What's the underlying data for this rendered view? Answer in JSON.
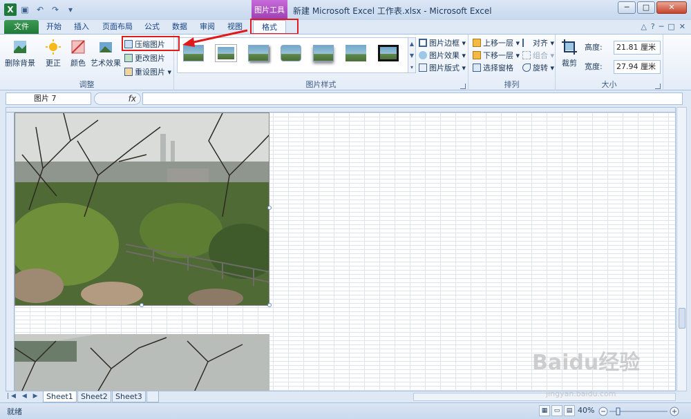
{
  "titlebar": {
    "app_icon": "X",
    "context_tab_title": "图片工具",
    "window_title": "新建 Microsoft Excel 工作表.xlsx - Microsoft Excel",
    "controls": [
      "─",
      "□",
      "✕"
    ]
  },
  "tabs": {
    "file": "文件",
    "items": [
      "开始",
      "插入",
      "页面布局",
      "公式",
      "数据",
      "审阅",
      "视图",
      "格式"
    ],
    "active": "格式",
    "right_icons": [
      "△",
      "?",
      "─",
      "□",
      "✕"
    ]
  },
  "ribbon": {
    "adjust_group": {
      "label": "调整",
      "remove_bg": "删除背景",
      "corrections": "更正",
      "color": "颜色",
      "artistic": "艺术效果",
      "compress": "压缩图片",
      "change": "更改图片",
      "reset": "重设图片"
    },
    "styles_group": {
      "label": "图片样式",
      "border": "图片边框",
      "effects": "图片效果",
      "layout": "图片版式"
    },
    "arrange_group": {
      "label": "排列",
      "bring_forward": "上移一层",
      "send_backward": "下移一层",
      "selection_pane": "选择窗格",
      "align": "对齐",
      "group": "组合",
      "rotate": "旋转"
    },
    "size_group": {
      "label": "大小",
      "crop": "裁剪",
      "height_label": "高度:",
      "height_value": "21.81 厘米",
      "width_label": "宽度:",
      "width_value": "27.94 厘米"
    }
  },
  "formula_bar": {
    "name_box": "图片 7",
    "fx": "fx"
  },
  "sheet_tabs": [
    "Sheet1",
    "Sheet2",
    "Sheet3"
  ],
  "status": {
    "ready": "就绪",
    "zoom": "40%"
  },
  "watermark": {
    "main": "Baidu经验",
    "sub": "jingyan.baidu.com"
  },
  "colors": {
    "file_tab": "#1f7a37",
    "context_tab": "#9a3fb2",
    "highlight": "#e0191b"
  }
}
